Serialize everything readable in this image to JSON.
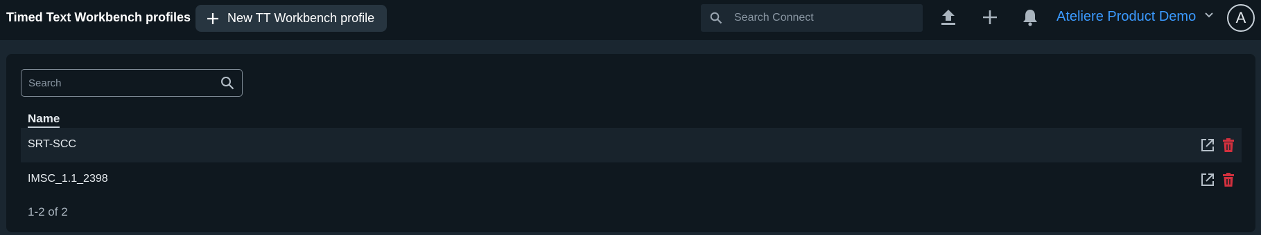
{
  "header": {
    "title": "Timed Text Workbench profiles",
    "new_button_label": "New TT Workbench profile",
    "search_placeholder": "Search Connect",
    "workspace_name": "Ateliere Product Demo",
    "avatar_initial": "A",
    "icons": [
      "search-icon",
      "upload-icon",
      "plus-icon",
      "bell-icon",
      "chevron-down-icon"
    ]
  },
  "list": {
    "search_placeholder": "Search",
    "column_name": "Name",
    "rows": [
      {
        "name": "SRT-SCC"
      },
      {
        "name": "IMSC_1.1_2398"
      }
    ],
    "pagination": "1-2 of 2"
  },
  "colors": {
    "accent": "#3b9aff",
    "delete": "#d2303e",
    "background": "#1a2630",
    "panel": "#0f181f"
  }
}
